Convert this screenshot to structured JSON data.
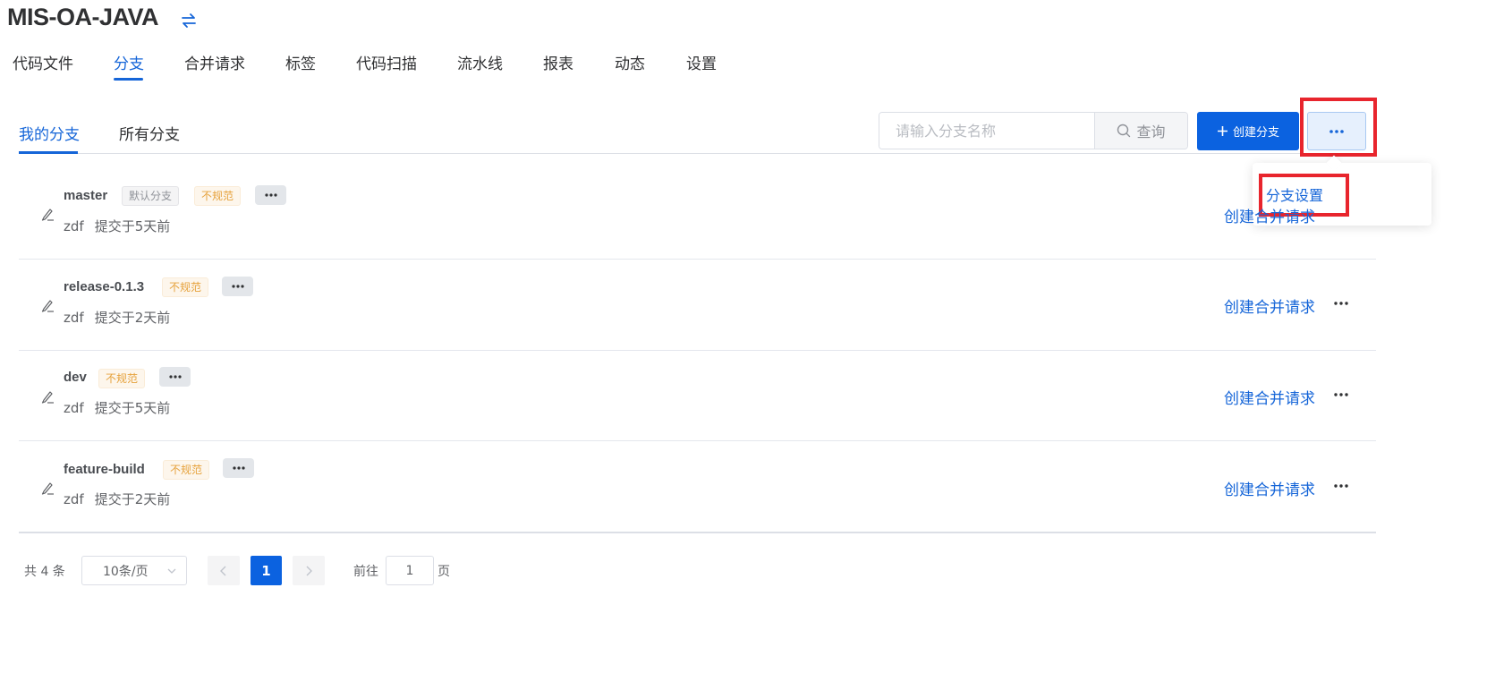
{
  "repo": {
    "title": "MIS-OA-JAVA",
    "switch_icon": "swap-arrows-icon"
  },
  "nav": {
    "items": [
      {
        "label": "代码文件"
      },
      {
        "label": "分支",
        "active": true
      },
      {
        "label": "合并请求"
      },
      {
        "label": "标签"
      },
      {
        "label": "代码扫描"
      },
      {
        "label": "流水线"
      },
      {
        "label": "报表"
      },
      {
        "label": "动态"
      },
      {
        "label": "设置"
      }
    ]
  },
  "subtabs": [
    {
      "label": "我的分支",
      "active": true
    },
    {
      "label": "所有分支"
    }
  ],
  "search": {
    "placeholder": "请输入分支名称",
    "value": "",
    "button_label": "查询"
  },
  "create_button": {
    "label": "创建分支",
    "icon": "plus-icon"
  },
  "more_menu": {
    "icon": "more-dots-icon",
    "items": [
      {
        "label": "分支设置"
      }
    ]
  },
  "branches": [
    {
      "name": "master",
      "tags": [
        "默认分支",
        "不规范"
      ],
      "author": "zdf",
      "commit": "提交于5天前",
      "action": "创建合并请求"
    },
    {
      "name": "release-0.1.3",
      "tags": [
        "不规范"
      ],
      "author": "zdf",
      "commit": "提交于2天前",
      "action": "创建合并请求"
    },
    {
      "name": "dev",
      "tags": [
        "不规范"
      ],
      "author": "zdf",
      "commit": "提交于5天前",
      "action": "创建合并请求"
    },
    {
      "name": "feature-build",
      "tags": [
        "不规范"
      ],
      "author": "zdf",
      "commit": "提交于2天前",
      "action": "创建合并请求"
    }
  ],
  "pagination": {
    "total_text": "共 4 条",
    "page_size": "10条/页",
    "current_page": "1",
    "goto_label": "前往",
    "goto_value": "1",
    "goto_suffix": "页"
  },
  "colors": {
    "primary": "#1565d8",
    "button": "#0b62e0",
    "warning_tag": "#e6a23c",
    "highlight": "#e8252d"
  }
}
